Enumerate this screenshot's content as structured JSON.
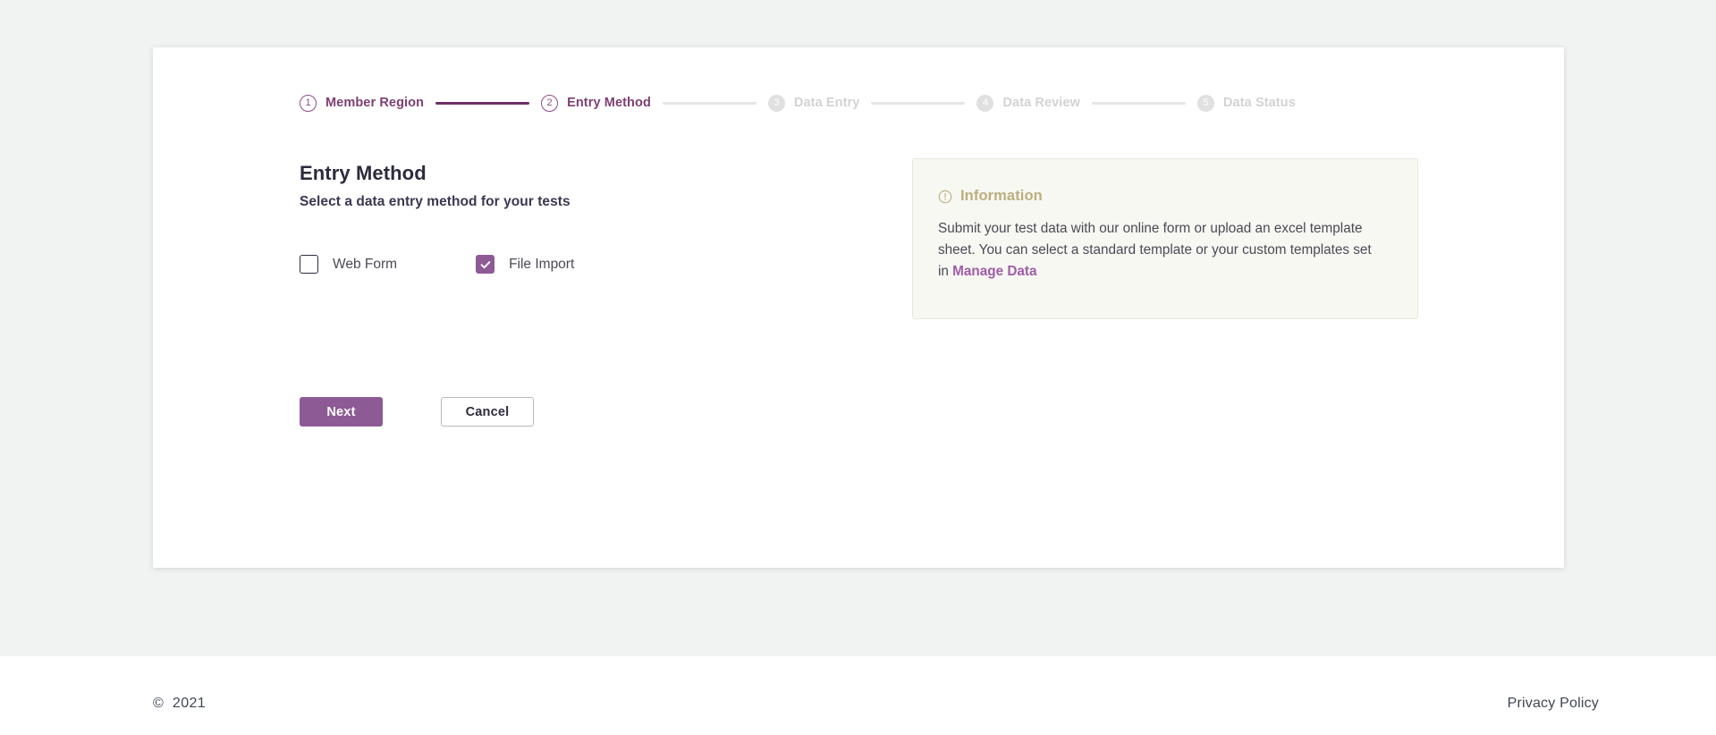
{
  "theme": {
    "accent_purple": "#8e5a96",
    "accent_purple_dark": "#6e2f63",
    "step_active_text": "#7e3f72",
    "step_inactive": "#d3d3d3",
    "info_title_color": "#bcae7e",
    "info_bg": "#f7f8f2",
    "page_bg": "#f1f2f2"
  },
  "stepper": {
    "steps": [
      {
        "number": "1",
        "label": "Member Region",
        "state": "active"
      },
      {
        "number": "2",
        "label": "Entry Method",
        "state": "active"
      },
      {
        "number": "3",
        "label": "Data Entry",
        "state": "inactive"
      },
      {
        "number": "4",
        "label": "Data Review",
        "state": "inactive"
      },
      {
        "number": "5",
        "label": "Data Status",
        "state": "inactive"
      }
    ],
    "connectors": [
      "done",
      "todo",
      "todo",
      "todo"
    ]
  },
  "main": {
    "title": "Entry Method",
    "subtitle": "Select a data entry method for your tests",
    "choices": [
      {
        "label": "Web Form",
        "checked": false,
        "icon": "checkbox-empty-icon"
      },
      {
        "label": "File Import",
        "checked": true,
        "icon": "checkbox-checked-icon"
      }
    ],
    "buttons": {
      "next": "Next",
      "cancel": "Cancel"
    }
  },
  "info": {
    "icon": "exclamation-circle-icon",
    "title": "Information",
    "body_part_1": "Submit your test data with our online form or upload an excel template sheet. You can select a standard template or your custom templates set in ",
    "link_label": "Manage Data"
  },
  "footer": {
    "copyright_symbol": "©",
    "copyright_year": "2021",
    "privacy_label": "Privacy Policy"
  }
}
